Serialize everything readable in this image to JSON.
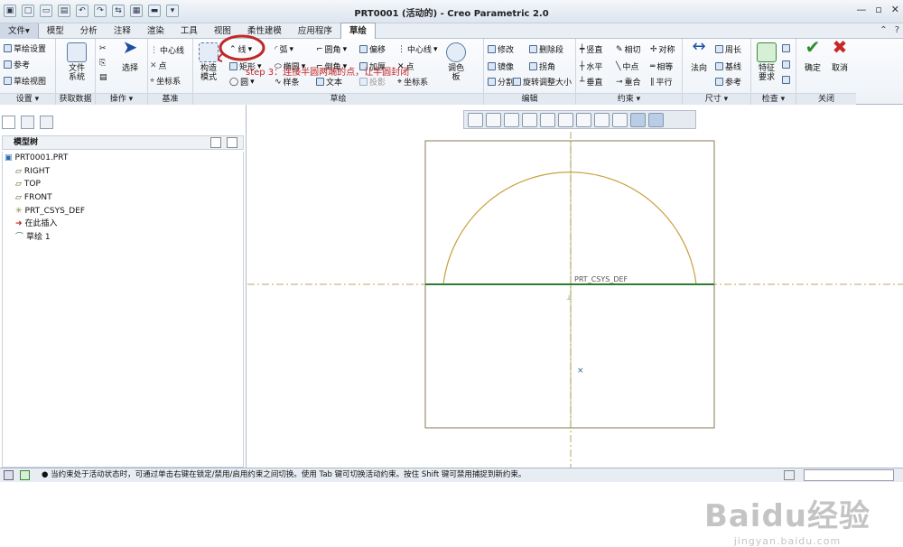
{
  "window": {
    "title": "PRT0001 (活动的) - Creo Parametric 2.0"
  },
  "menubar": {
    "items": [
      "文件▾",
      "模型",
      "分析",
      "注释",
      "渲染",
      "工具",
      "视图",
      "柔性建模",
      "应用程序",
      "草绘"
    ],
    "active": "草绘"
  },
  "ribbon": {
    "setup": {
      "label": "设置 ▾",
      "items": [
        "草绘设置",
        "参考",
        "草绘视图"
      ]
    },
    "getdata": {
      "label": "获取数据",
      "file_system": "文件\n系统"
    },
    "operations": {
      "label": "操作 ▾",
      "select": "选择"
    },
    "datum": {
      "label": "基准",
      "items": [
        "中心线",
        "点",
        "坐标系"
      ]
    },
    "sketch": {
      "label": "草绘",
      "construction": "构造\n模式",
      "line": "线",
      "rect": "矩形",
      "circle": "圆",
      "arc": "弧",
      "ellipse": "椭圆",
      "spline": "样条",
      "fillet": "圆角",
      "chamfer": "倒角",
      "text": "文本",
      "offset": "偏移",
      "thicken": "加厚",
      "project": "投影",
      "centerline": "中心线",
      "point": "点",
      "csys": "坐标系",
      "palette": "调色\n板"
    },
    "edit": {
      "label": "编辑",
      "items": [
        "修改",
        "删除段",
        "镜像",
        "拐角",
        "分割",
        "旋转调整大小"
      ]
    },
    "constraint": {
      "label": "约束 ▾",
      "items": [
        "竖直",
        "相切",
        "对称",
        "水平",
        "中点",
        "相等",
        "垂直",
        "重合",
        "平行"
      ]
    },
    "dimension": {
      "label": "尺寸 ▾",
      "normal": "法向",
      "items": [
        "周长",
        "基线",
        "参考"
      ]
    },
    "inspect": {
      "label": "检查 ▾",
      "feature_req": "特征\n要求"
    },
    "close": {
      "label": "关闭",
      "ok": "确定",
      "cancel": "取消"
    }
  },
  "annotation": {
    "text": "step 3：连接半圆两端的点，让半圆封闭"
  },
  "model_tree": {
    "header": "模型树",
    "items": [
      {
        "label": "PRT0001.PRT",
        "icon": "part-icon"
      },
      {
        "label": "RIGHT",
        "icon": "datum-plane-icon"
      },
      {
        "label": "TOP",
        "icon": "datum-plane-icon"
      },
      {
        "label": "FRONT",
        "icon": "datum-plane-icon"
      },
      {
        "label": "PRT_CSYS_DEF",
        "icon": "csys-icon"
      },
      {
        "label": "在此插入",
        "icon": "insert-arrow-icon"
      },
      {
        "label": "草绘 1",
        "icon": "sketch-icon"
      }
    ]
  },
  "canvas": {
    "csys_label": "PRT_CSYS_DEF"
  },
  "status": {
    "message": "● 当约束处于活动状态时，可通过单击右键在锁定/禁用/启用约束之间切换。使用 Tab 键可切换活动约束。按住 Shift 键可禁用捕捉到新约束。"
  },
  "watermark": {
    "brand": "Baidu经验",
    "url": "jingyan.baidu.com"
  },
  "colors": {
    "sketch_geom": "#c8a040",
    "centerline": "#9a8a30",
    "highlight": "#2e7d32",
    "annotation": "#c0282a"
  }
}
